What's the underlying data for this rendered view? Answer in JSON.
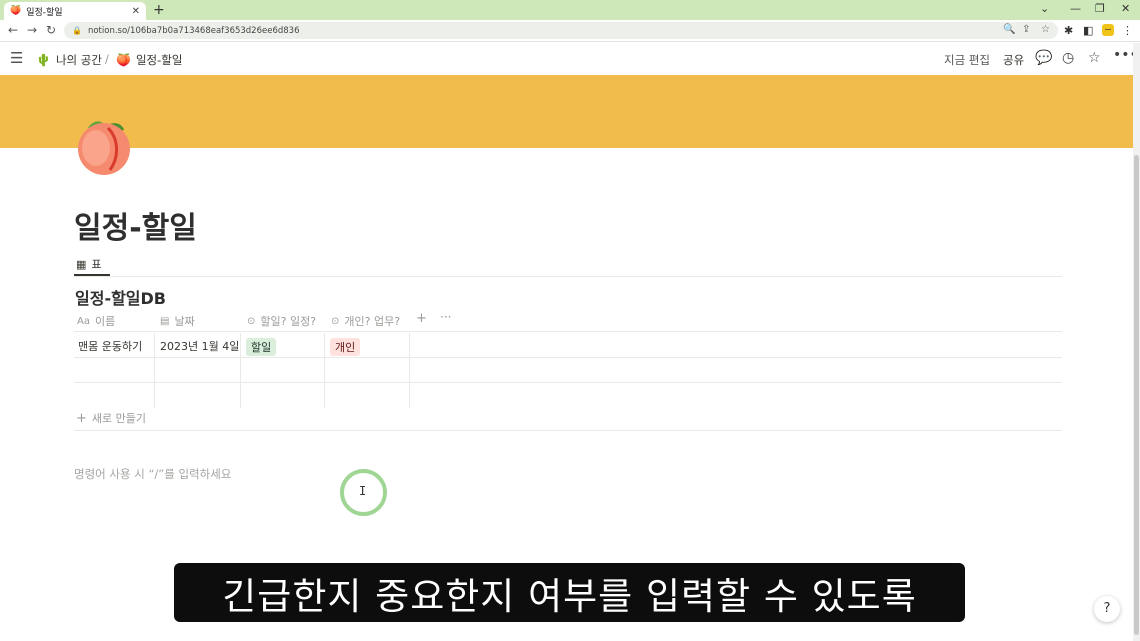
{
  "browser": {
    "tab_title": "일정-할일",
    "tab_favicon": "🍑",
    "url": "notion.so/106ba7b0a713468eaf3653d26ee6d836"
  },
  "header": {
    "workspace": "나의 공간",
    "workspace_icon": "🌵",
    "separator": "/",
    "page": "일정-할일",
    "page_icon": "🍑",
    "edit_time": "지금 편집",
    "share": "공유"
  },
  "cover_color": "#f2bc4c",
  "page_title": "일정-할일",
  "view_tab": "표",
  "database": {
    "title": "일정-할일DB",
    "columns": [
      {
        "icon": "Aa",
        "label": "이름"
      },
      {
        "icon": "calendar-icon",
        "label": "날짜"
      },
      {
        "icon": "select-icon",
        "label": "할일? 일정?"
      },
      {
        "icon": "select-icon",
        "label": "개인? 업무?"
      }
    ],
    "rows": [
      {
        "name": "맨몸 운동하기",
        "date": "2023년 1월 4일",
        "type": "할일",
        "category": "개인"
      }
    ],
    "new_row": "새로 만들기"
  },
  "editor_placeholder": "명령어 사용 시 “/”를 입력하세요",
  "subtitle": "긴급한지 중요한지 여부를 입력할 수 있도록",
  "help_label": "?"
}
